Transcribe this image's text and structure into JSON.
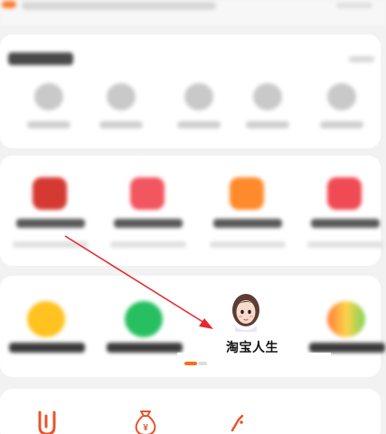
{
  "highlighted_item": {
    "label": "淘宝人生",
    "icon": "cartoon-avatar-icon"
  },
  "carousel": {
    "active_page": 1,
    "total_pages": 2
  },
  "bottom_icons": [
    "u-shape-icon",
    "money-bag-yen-icon",
    "partial-icon"
  ],
  "bottom_icon_glyphs": {
    "money_bag": "¥"
  },
  "annotation": {
    "arrow_color": "#e8282e",
    "arrow_icon": "red-arrow-icon"
  },
  "colors": {
    "accent": "#ff6a1a",
    "card_bg": "#ffffff",
    "page_bg": "#f2f2f2"
  }
}
